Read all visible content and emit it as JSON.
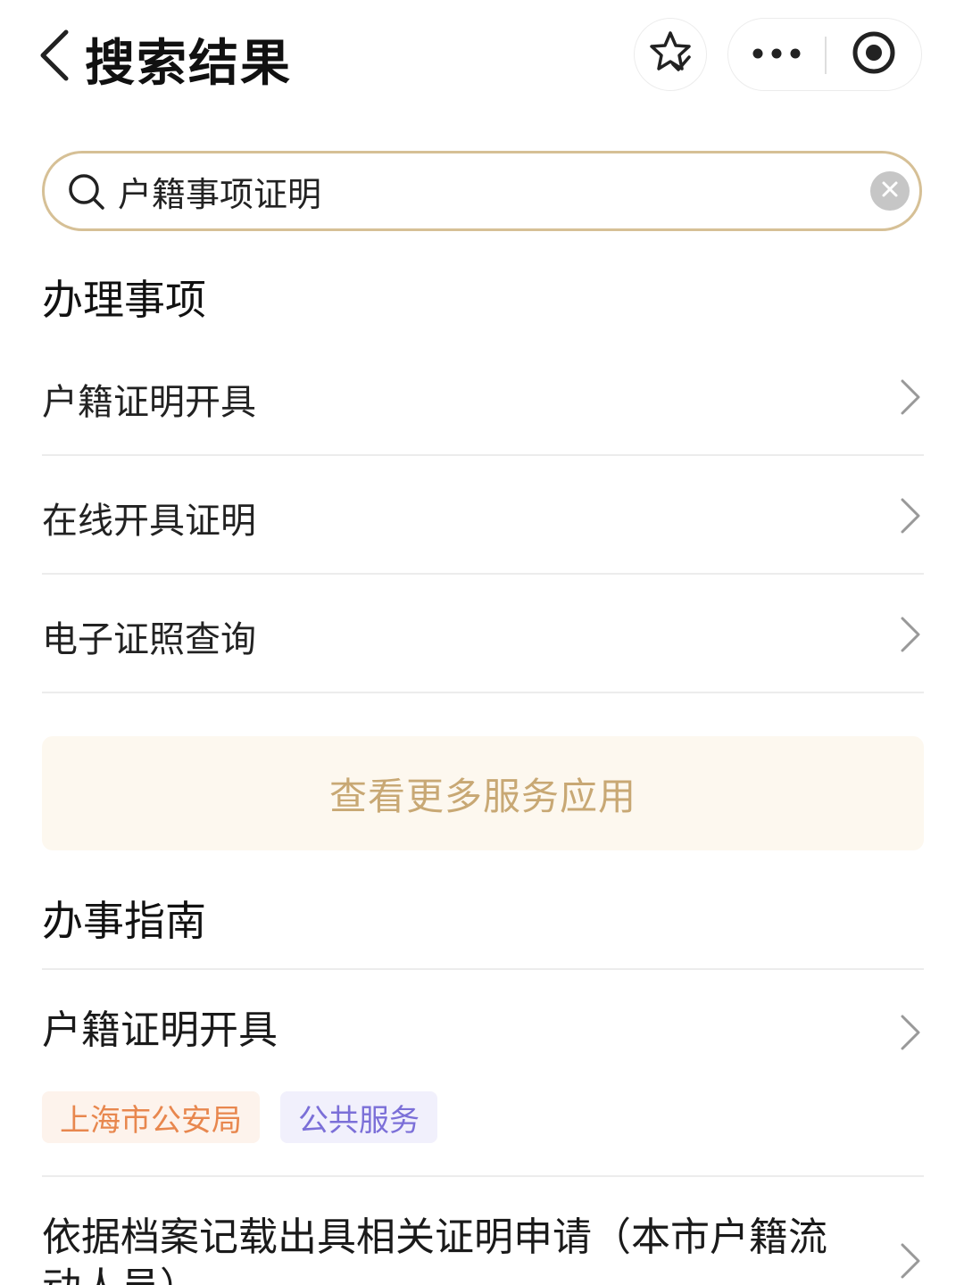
{
  "header": {
    "title": "搜索结果",
    "icons": {
      "back": "chevron-left-icon",
      "favorite": "star-check-icon",
      "more": "more-dots-icon",
      "close": "target-circle-icon"
    }
  },
  "search": {
    "value": "户籍事项证明",
    "placeholder": "",
    "icons": {
      "search": "search-icon",
      "clear": "clear-circle-icon"
    }
  },
  "services_section": {
    "title": "办理事项",
    "items": [
      {
        "label": "户籍证明开具"
      },
      {
        "label": "在线开具证明"
      },
      {
        "label": "电子证照查询"
      }
    ],
    "more_label": "查看更多服务应用"
  },
  "guide_section": {
    "title": "办事指南",
    "items": [
      {
        "title": "户籍证明开具",
        "tags": [
          {
            "label": "上海市公安局"
          },
          {
            "label": "公共服务"
          }
        ]
      },
      {
        "title": "依据档案记载出具相关证明申请（本市户籍流动人员）",
        "tags": []
      }
    ]
  },
  "colors": {
    "accent_border": "#d6c096",
    "more_button_bg": "#fdf8ef",
    "more_button_text": "#c8a874",
    "tag_dept_text": "#e8874e",
    "tag_dept_bg": "#fdf3ec",
    "tag_category_text": "#7b6fd8",
    "tag_category_bg": "#f1f0fc"
  }
}
